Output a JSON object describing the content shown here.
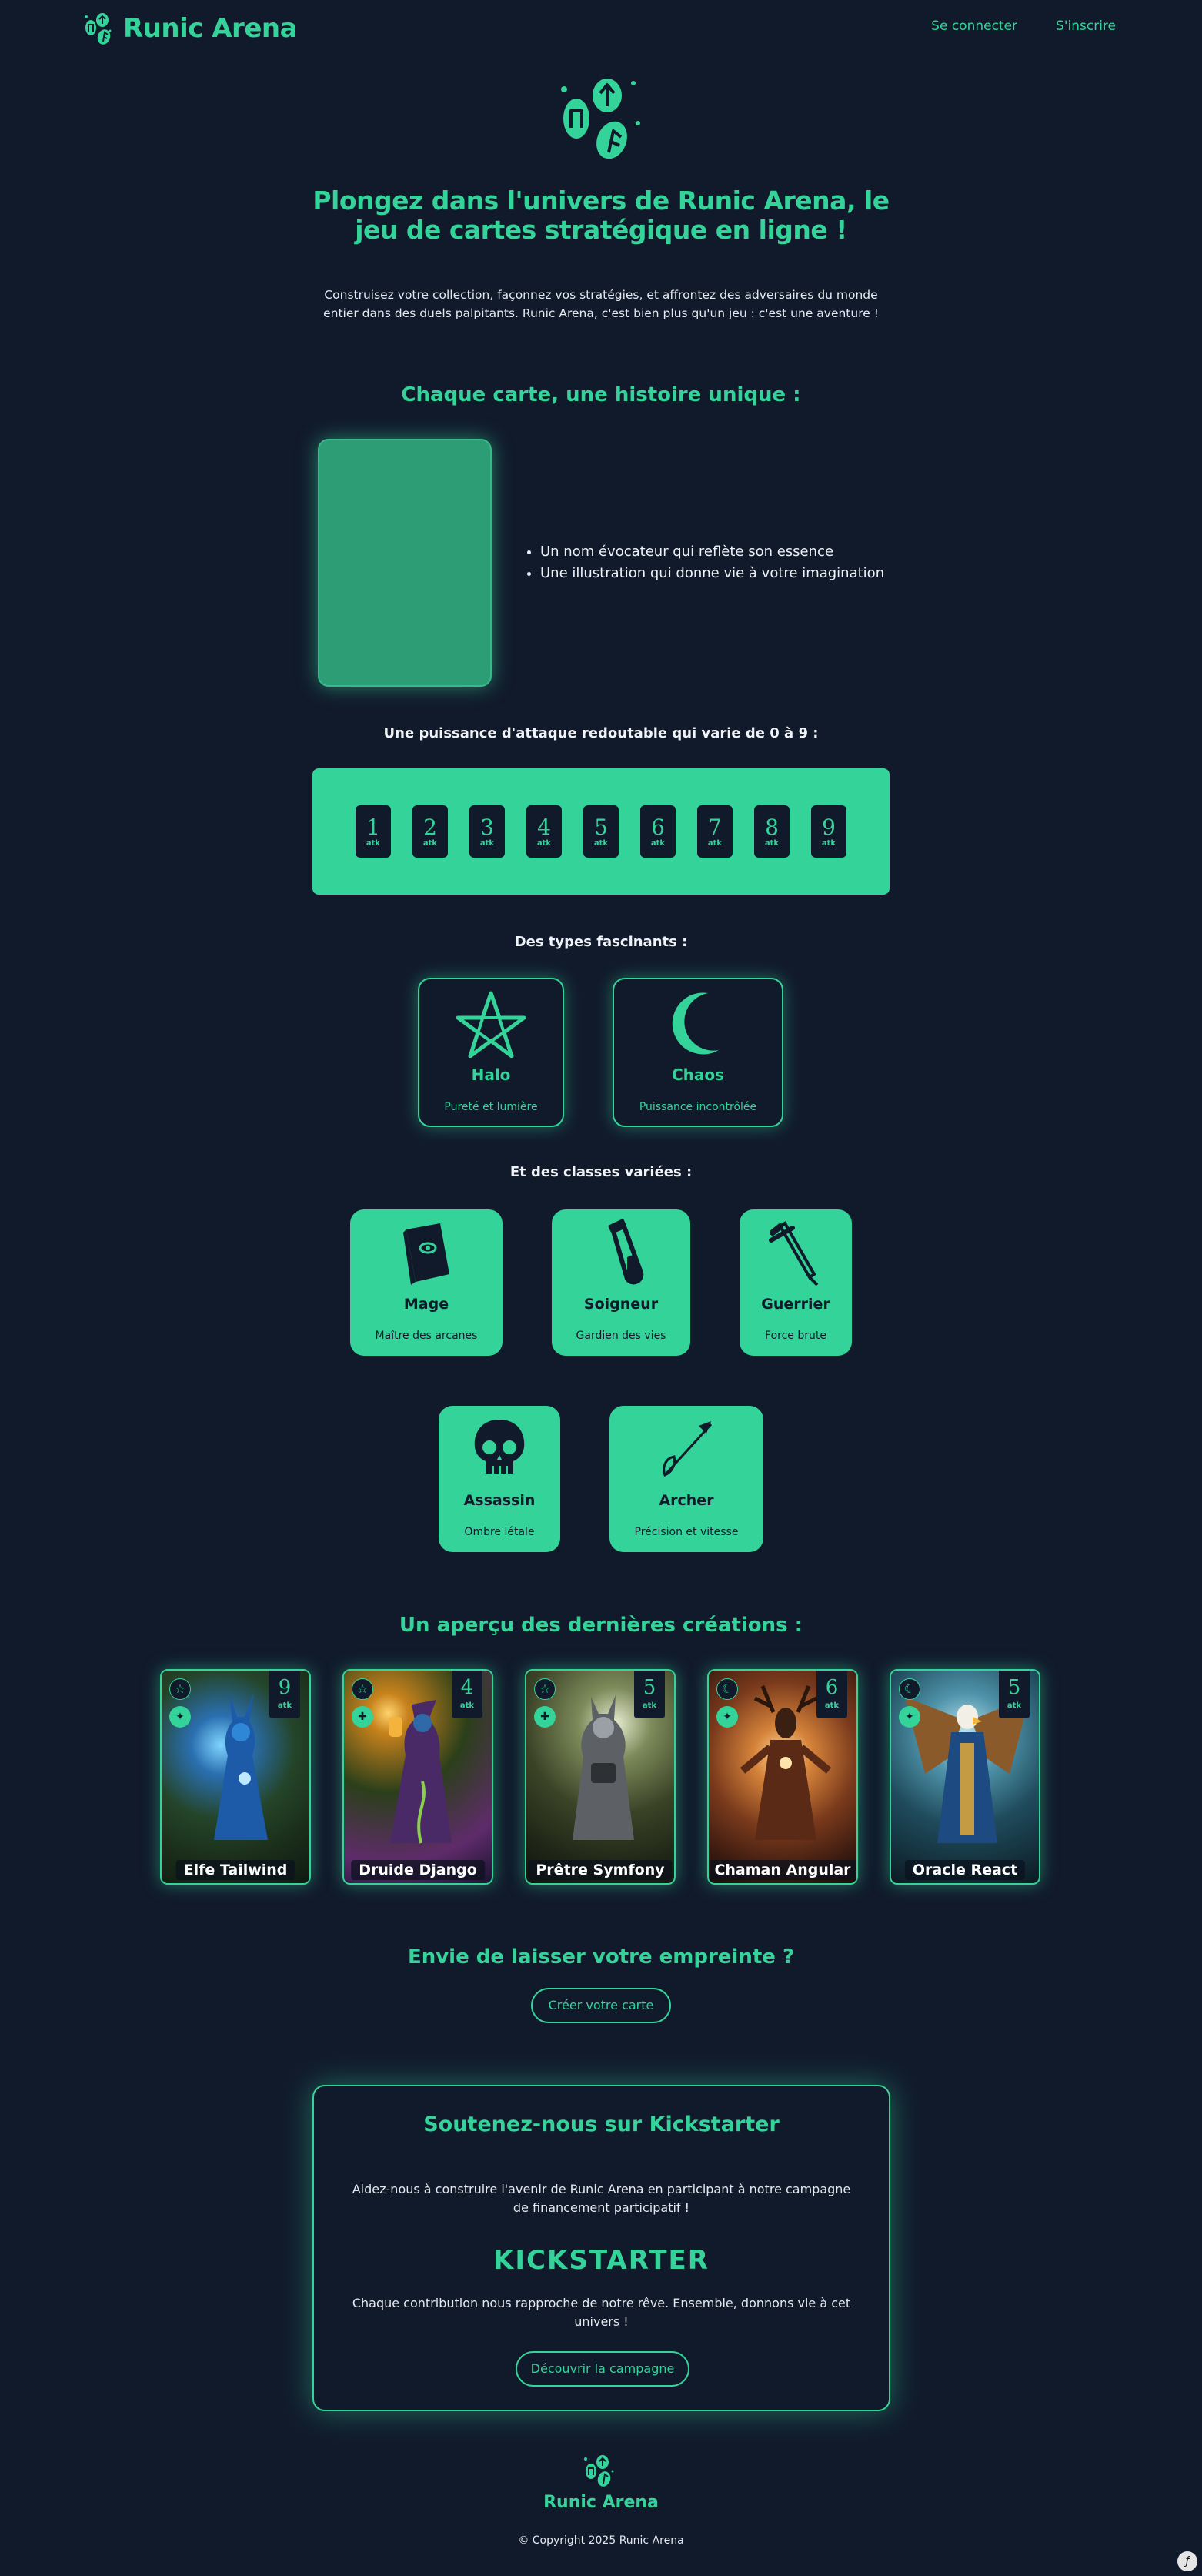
{
  "nav": {
    "brand": "Runic Arena",
    "login": "Se connecter",
    "signup": "S'inscrire"
  },
  "hero": {
    "title": "Plongez dans l'univers de Runic Arena, le jeu de cartes stratégique en ligne !",
    "text": "Construisez votre collection, façonnez vos stratégies, et affrontez des adversaires du monde entier dans des duels palpitants. Runic Arena, c'est bien plus qu'un jeu : c'est une aventure !"
  },
  "story": {
    "title": "Chaque carte, une histoire unique :",
    "bullets": [
      "Un nom évocateur qui reflète son essence",
      "Une illustration qui donne vie à votre imagination"
    ]
  },
  "attack": {
    "title": "Une puissance d'attaque redoutable qui varie de 0 à 9 :",
    "values": [
      "1",
      "2",
      "3",
      "4",
      "5",
      "6",
      "7",
      "8",
      "9"
    ],
    "unit": "atk"
  },
  "types": {
    "title": "Des types fascinants :",
    "items": [
      {
        "name": "Halo",
        "desc": "Pureté et lumière",
        "icon": "pentagram-icon"
      },
      {
        "name": "Chaos",
        "desc": "Puissance incontrôlée",
        "icon": "crescent-moon-icon"
      }
    ]
  },
  "classes": {
    "title": "Et des classes variées :",
    "items": [
      {
        "name": "Mage",
        "desc": "Maître des arcanes",
        "icon": "spellbook-icon"
      },
      {
        "name": "Soigneur",
        "desc": "Gardien des vies",
        "icon": "potion-vial-icon"
      },
      {
        "name": "Guerrier",
        "desc": "Force brute",
        "icon": "sword-icon"
      },
      {
        "name": "Assassin",
        "desc": "Ombre létale",
        "icon": "skull-icon"
      },
      {
        "name": "Archer",
        "desc": "Précision et vitesse",
        "icon": "arrow-icon"
      }
    ]
  },
  "gallery": {
    "title": "Un aperçu des dernières créations :",
    "cards": [
      {
        "name": "Elfe Tailwind",
        "atk": "9",
        "type": "Halo"
      },
      {
        "name": "Druide Django",
        "atk": "4",
        "type": "Halo"
      },
      {
        "name": "Prêtre Symfony",
        "atk": "5",
        "type": "Halo"
      },
      {
        "name": "Chaman Angular",
        "atk": "6",
        "type": "Chaos"
      },
      {
        "name": "Oracle React",
        "atk": "5",
        "type": "Chaos"
      }
    ]
  },
  "cta": {
    "title": "Envie de laisser votre empreinte ?",
    "button": "Créer votre carte"
  },
  "kickstarter": {
    "title": "Soutenez-nous sur Kickstarter",
    "text1": "Aidez-nous à construire l'avenir de Runic Arena en participant à notre campagne de financement participatif !",
    "logo": "KICKSTARTER",
    "text2": "Chaque contribution nous rapproche de notre rêve. Ensemble, donnons vie à cet univers !",
    "button": "Découvrir la campagne"
  },
  "footer": {
    "brand": "Runic Arena",
    "copyright": "© Copyright 2025 Runic Arena"
  },
  "colors": {
    "background": "#111a2b",
    "accent": "#34d399"
  }
}
